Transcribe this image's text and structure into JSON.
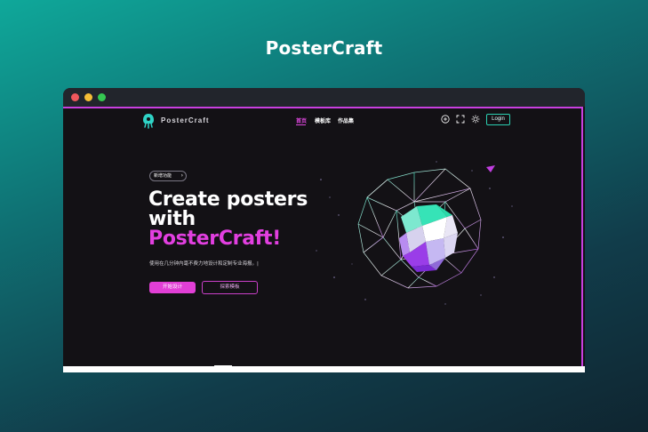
{
  "page": {
    "title": "PosterCraft"
  },
  "app": {
    "brand": "PosterCraft",
    "nav": [
      {
        "label": "首页",
        "active": true
      },
      {
        "label": "模板库",
        "active": false
      },
      {
        "label": "作品集",
        "active": false
      }
    ],
    "icons": [
      "add-icon",
      "expand-icon",
      "theme-sun-icon"
    ],
    "login_label": "Login"
  },
  "hero": {
    "badge": "新增功能",
    "headline_line1": "Create posters",
    "headline_line2": "with",
    "headline_accent": "PosterCraft!",
    "subtitle": "使用在几分钟内毫不费力地设计和定制专业海报。|",
    "primary_button": "开始设计",
    "secondary_button": "探索模板"
  },
  "colors": {
    "accent": "#e23fd6",
    "teal": "#2bcfb1",
    "background": "#131115"
  }
}
